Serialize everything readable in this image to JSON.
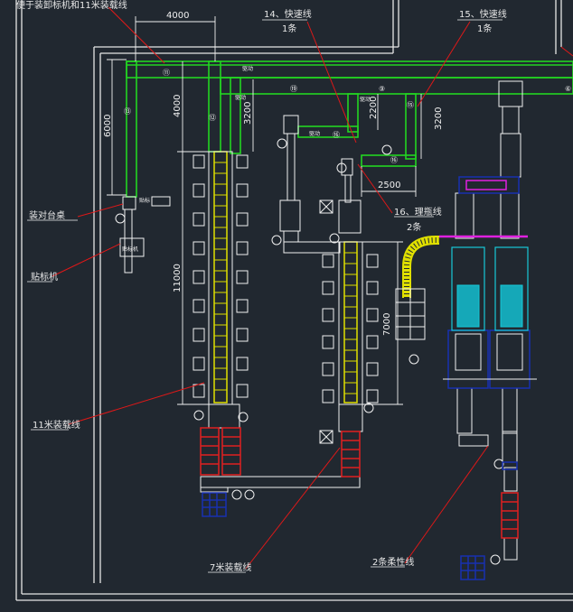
{
  "labels": {
    "top_left": "便于装卸标机和11米装载线",
    "pack_table": "装对台桌",
    "label_machine": "贴标机",
    "line_11m": "11米装载线",
    "line_7m": "7米装载线",
    "flex_line": "2条柔性线",
    "conveyor_14": "14、快速线",
    "conveyor_14_count": "1条",
    "conveyor_15": "15、快速线",
    "conveyor_15_count": "1条",
    "conveyor_16": "16、理瓶线",
    "conveyor_16_count": "2条",
    "machine_small": "贴标机"
  },
  "dimensions": {
    "d4000_top": "4000",
    "d6000": "6000",
    "d4000_v": "4000",
    "d3200_a": "3200",
    "d2200": "2200",
    "d3200_b": "3200",
    "d2500": "2500",
    "d11000": "11000",
    "d7000": "7000"
  },
  "callouts": {
    "c11": "⑪",
    "c12": "⑫",
    "c13": "⑬",
    "c19": "⑲",
    "c9": "⑨",
    "c15": "⑮",
    "c6": "⑥",
    "c16a": "⑯",
    "c16b": "⑯"
  },
  "tags": {
    "t1": "驱动",
    "t2": "驱动",
    "t3": "驱动",
    "t4": "驱动",
    "t5": "贴标"
  },
  "colors": {
    "background": "#212830",
    "wall": "#e6e6e6",
    "green_conveyor": "#22d422",
    "yellow_conveyor": "#e0e000",
    "red_leader": "#e01818",
    "machine_white": "#f0f0f0",
    "red_unit": "#e02020",
    "blue_unit": "#1830b0",
    "cyan_unit": "#18c8d8",
    "magenta": "#e020e0"
  }
}
